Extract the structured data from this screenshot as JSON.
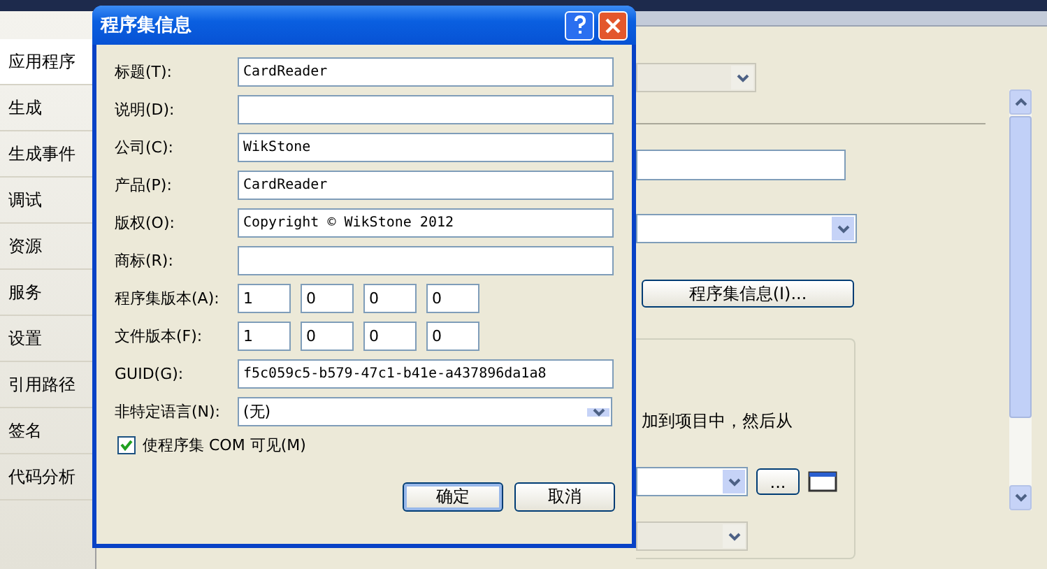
{
  "sidebar": {
    "items": [
      {
        "label": "应用程序",
        "selected": true
      },
      {
        "label": "生成",
        "selected": false
      },
      {
        "label": "生成事件",
        "selected": false
      },
      {
        "label": "调试",
        "selected": false
      },
      {
        "label": "资源",
        "selected": false
      },
      {
        "label": "服务",
        "selected": false
      },
      {
        "label": "设置",
        "selected": false
      },
      {
        "label": "引用路径",
        "selected": false
      },
      {
        "label": "签名",
        "selected": false
      },
      {
        "label": "代码分析",
        "selected": false
      }
    ]
  },
  "page": {
    "assembly_info_button": "程序集信息(I)...",
    "partial_text": "加到项目中，然后从",
    "browse_button": "..."
  },
  "dialog": {
    "title": "程序集信息",
    "fields": [
      {
        "kind": "text",
        "label": "标题(T):",
        "value": "CardReader"
      },
      {
        "kind": "text",
        "label": "说明(D):"
      },
      {
        "kind": "text",
        "label": "公司(C):",
        "value": "WikStone"
      },
      {
        "kind": "text",
        "label": "产品(P):",
        "value": "CardReader"
      },
      {
        "kind": "text",
        "label": "版权(O):",
        "value": "Copyright © WikStone 2012"
      },
      {
        "kind": "text",
        "label": "商标(R):"
      },
      {
        "kind": "version",
        "label": "程序集版本(A):",
        "parts": [
          "1",
          "0",
          "0",
          "0"
        ]
      },
      {
        "kind": "version",
        "label": "文件版本(F):",
        "parts": [
          "1",
          "0",
          "0",
          "0"
        ]
      },
      {
        "kind": "text",
        "label": "GUID(G):",
        "value": "f5c059c5-b579-47c1-b41e-a437896da1a8"
      },
      {
        "kind": "select",
        "label": "非特定语言(N):",
        "value": "(无)"
      }
    ],
    "com_visible": {
      "label": "使程序集 COM 可见(M)",
      "checked": true
    },
    "buttons": [
      "确定",
      "取消"
    ]
  }
}
